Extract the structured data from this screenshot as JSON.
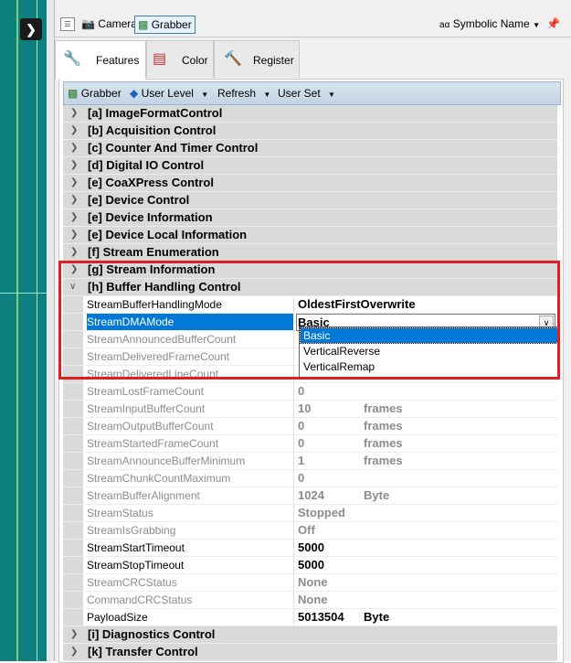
{
  "topbar": {
    "camera_label": "Camera",
    "grabber_label": "Grabber",
    "symbolic_label": "Symbolic Name"
  },
  "tabs": [
    {
      "label": "Features",
      "active": true
    },
    {
      "label": "Color",
      "active": false
    },
    {
      "label": "Register",
      "active": false
    }
  ],
  "toolbar": {
    "grabber": "Grabber",
    "user_level": "User Level",
    "refresh": "Refresh",
    "user_set": "User Set"
  },
  "categories": {
    "a": "[a] ImageFormatControl",
    "b": "[b] Acquisition Control",
    "c": "[c] Counter And Timer Control",
    "d": "[d] Digital IO Control",
    "e1": "[e] CoaXPress Control",
    "e2": "[e] Device Control",
    "e3": "[e] Device Information",
    "e4": "[e] Device Local Information",
    "f": "[f] Stream Enumeration",
    "g": "[g] Stream Information",
    "h": "[h] Buffer Handling Control",
    "i": "[i] Diagnostics Control",
    "k": "[k] Transfer Control"
  },
  "props": [
    {
      "name": "StreamBufferHandlingMode",
      "value": "OldestFirstOverwrite",
      "unit": ""
    },
    {
      "name": "StreamDMAMode",
      "value": "Basic",
      "unit": ""
    },
    {
      "name": "StreamAnnouncedBufferCount",
      "value": "",
      "unit": ""
    },
    {
      "name": "StreamDeliveredFrameCount",
      "value": "",
      "unit": ""
    },
    {
      "name": "StreamDeliveredLineCount",
      "value": "",
      "unit": ""
    },
    {
      "name": "StreamLostFrameCount",
      "value": "0",
      "unit": ""
    },
    {
      "name": "StreamInputBufferCount",
      "value": "10",
      "unit": "frames"
    },
    {
      "name": "StreamOutputBufferCount",
      "value": "0",
      "unit": "frames"
    },
    {
      "name": "StreamStartedFrameCount",
      "value": "0",
      "unit": "frames"
    },
    {
      "name": "StreamAnnounceBufferMinimum",
      "value": "1",
      "unit": "frames"
    },
    {
      "name": "StreamChunkCountMaximum",
      "value": "0",
      "unit": ""
    },
    {
      "name": "StreamBufferAlignment",
      "value": "1024",
      "unit": "Byte"
    },
    {
      "name": "StreamStatus",
      "value": "Stopped",
      "unit": ""
    },
    {
      "name": "StreamIsGrabbing",
      "value": "Off",
      "unit": ""
    },
    {
      "name": "StreamStartTimeout",
      "value": "5000",
      "unit": ""
    },
    {
      "name": "StreamStopTimeout",
      "value": "5000",
      "unit": ""
    },
    {
      "name": "StreamCRCStatus",
      "value": "None",
      "unit": ""
    },
    {
      "name": "CommandCRCStatus",
      "value": "None",
      "unit": ""
    },
    {
      "name": "PayloadSize",
      "value": "5013504",
      "unit": "Byte"
    }
  ],
  "dropdown_options": [
    "Basic",
    "VerticalReverse",
    "VerticalRemap"
  ],
  "colors": {
    "accent": "#0078d7",
    "highlight_box": "#e01e24",
    "left_panel": "#0d7f7f"
  }
}
